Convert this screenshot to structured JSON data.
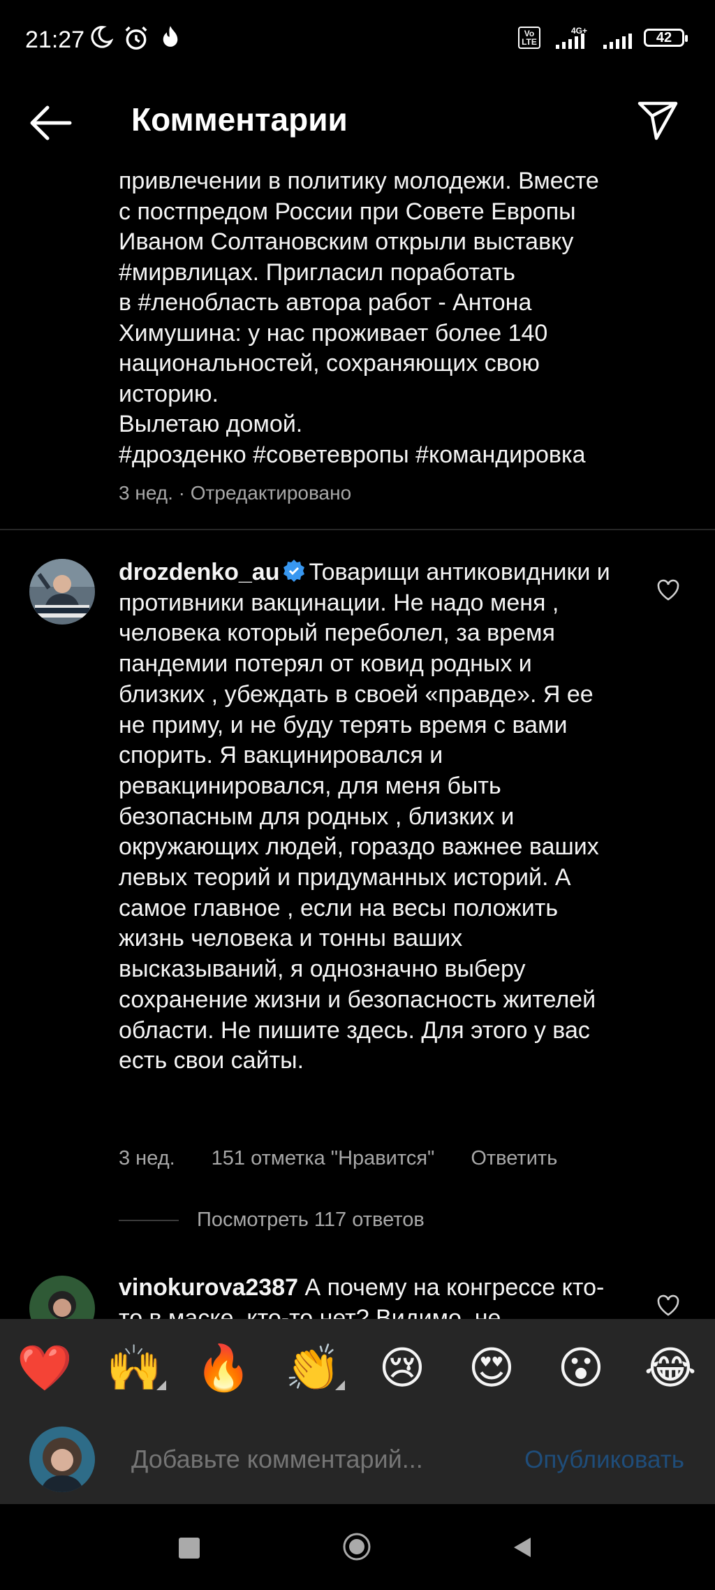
{
  "status_bar": {
    "time": "21:27",
    "network": "4G+",
    "volte": "Vo LTE",
    "battery": "42",
    "icons": [
      "moon-icon",
      "alarm-icon",
      "flame-icon",
      "signal-icon",
      "wifi-icon",
      "battery-icon"
    ]
  },
  "header": {
    "title": "Комментарии",
    "back_icon": "arrow-left-icon",
    "share_icon": "send-icon"
  },
  "caption": {
    "text": "привлечении в политику молодежи. Вместе\nс постпредом России при Совете Европы\nИваном Солтановским открыли выставку\n#мирвлицах. Пригласил поработать\nв #ленобласть автора работ - Антона\nХимушина: у нас проживает более 140\nнациональностей, сохраняющих свою\nисторию.\nВылетаю домой.\n#дрозденко #советевропы #командировка",
    "meta": "3 нед. · Отредактировано"
  },
  "comments": [
    {
      "username": "drozdenko_au",
      "verified": true,
      "text": "Товарищи антиковидники и противники вакцинации. Не надо меня , человека который переболел, за время пандемии потерял от ковид родных и близких , убеждать в своей «правде». Я ее не приму, и не буду терять время с вами спорить. Я вакцинировался и ревакцинировался, для меня быть безопасным для родных , близких и окружающих людей, гораздо важнее ваших левых теорий и придуманных историй. А самое главное , если на весы положить жизнь человека и тонны ваших высказываний, я однозначно выберу сохранение жизни и безопасность жителей области. Не пишите здесь. Для этого у вас есть свои сайты.",
      "time": "3 нед.",
      "likes": "151 отметка \"Нравится\"",
      "reply": "Ответить",
      "view_replies": "Посмотреть 117 ответов"
    },
    {
      "username": "vinokurova2387",
      "verified": false,
      "text": "А почему на конгрессе кто-то в маске, кто-то нет? Видимо, не"
    }
  ],
  "emoji_bar": [
    "❤️",
    "🙌",
    "🔥",
    "👏",
    "😢",
    "😍",
    "😮",
    "😂"
  ],
  "composer": {
    "placeholder": "Добавьте комментарий...",
    "publish": "Опубликовать"
  },
  "colors": {
    "background": "#000000",
    "panel": "#262626",
    "muted_text": "#a8a8a8",
    "publish_disabled": "#1f4d7a",
    "verified": "#3897f0"
  }
}
